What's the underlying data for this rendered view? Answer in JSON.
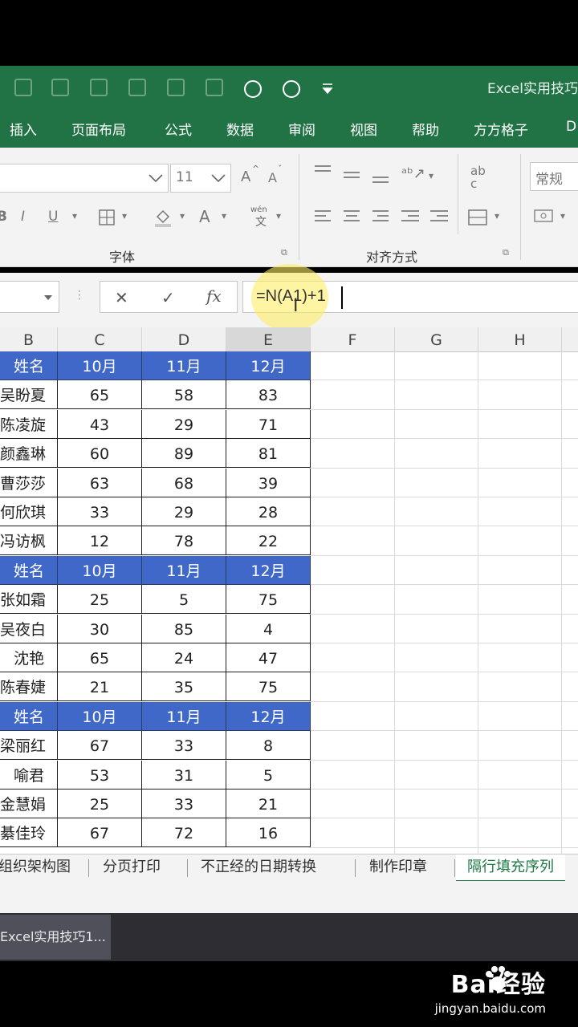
{
  "window": {
    "title": "Excel实用技巧"
  },
  "menu_tabs": [
    "插入",
    "页面布局",
    "公式",
    "数据",
    "审阅",
    "视图",
    "帮助",
    "方方格子",
    "D"
  ],
  "ribbon": {
    "font_size": "11",
    "number_format": "常规",
    "font_group_label": "字体",
    "align_group_label": "对齐方式",
    "increase_font": "A",
    "decrease_font": "A",
    "bold": "B",
    "italic": "I",
    "underline": "U",
    "font_color": "A",
    "wen": "wén",
    "ab": "ab",
    "wrap_c": "c"
  },
  "formula_bar": {
    "cancel": "✕",
    "enter": "✓",
    "fx": "fx",
    "formula": "=N(A1)+1"
  },
  "columns": [
    "B",
    "C",
    "D",
    "E",
    "F",
    "G",
    "H"
  ],
  "rows": [
    {
      "header": true,
      "cells": [
        "姓名",
        "10月",
        "11月",
        "12月"
      ]
    },
    {
      "header": false,
      "cells": [
        "吴盼夏",
        "65",
        "58",
        "83"
      ]
    },
    {
      "header": false,
      "cells": [
        "陈凌旋",
        "43",
        "29",
        "71"
      ]
    },
    {
      "header": false,
      "cells": [
        "颜鑫琳",
        "60",
        "89",
        "81"
      ]
    },
    {
      "header": false,
      "cells": [
        "曹莎莎",
        "63",
        "68",
        "39"
      ]
    },
    {
      "header": false,
      "cells": [
        "何欣琪",
        "33",
        "29",
        "28"
      ]
    },
    {
      "header": false,
      "cells": [
        "冯访枫",
        "12",
        "78",
        "22"
      ]
    },
    {
      "header": true,
      "cells": [
        "姓名",
        "10月",
        "11月",
        "12月"
      ]
    },
    {
      "header": false,
      "cells": [
        "张如霜",
        "25",
        "5",
        "75"
      ]
    },
    {
      "header": false,
      "cells": [
        "吴夜白",
        "30",
        "85",
        "4"
      ]
    },
    {
      "header": false,
      "cells": [
        "沈艳",
        "65",
        "24",
        "47"
      ]
    },
    {
      "header": false,
      "cells": [
        "陈春婕",
        "21",
        "35",
        "75"
      ]
    },
    {
      "header": true,
      "cells": [
        "姓名",
        "10月",
        "11月",
        "12月"
      ]
    },
    {
      "header": false,
      "cells": [
        "梁丽红",
        "67",
        "33",
        "8"
      ]
    },
    {
      "header": false,
      "cells": [
        "喻君",
        "53",
        "31",
        "5"
      ]
    },
    {
      "header": false,
      "cells": [
        "金慧娟",
        "25",
        "33",
        "21"
      ]
    },
    {
      "header": false,
      "cells": [
        "綦佳玲",
        "67",
        "72",
        "16"
      ]
    }
  ],
  "sheet_tabs": [
    "组织架构图",
    "分页打印",
    "不正经的日期转换",
    "制作印章",
    "隔行填充序列"
  ],
  "taskbar": {
    "item": "Excel实用技巧1..."
  },
  "watermark": {
    "main": "Bai经验",
    "sub": "jingyan.baidu.com"
  },
  "colors": {
    "excel_green": "#217346",
    "header_fill": "#3f68c9"
  }
}
